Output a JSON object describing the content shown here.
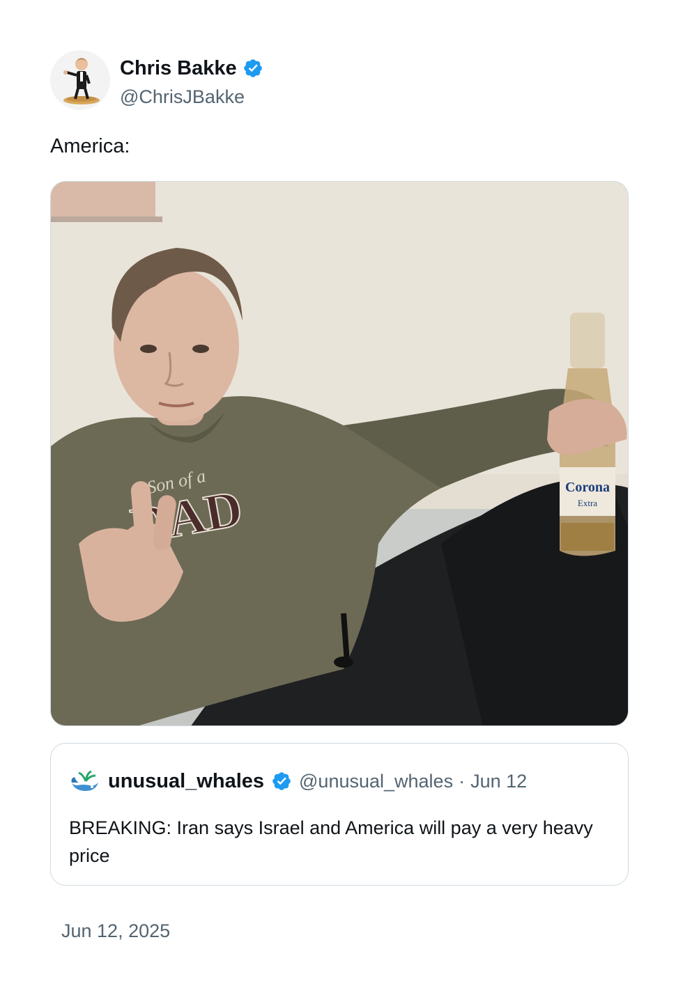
{
  "author": {
    "display_name": "Chris Bakke",
    "handle": "@ChrisJBakke",
    "verified": true,
    "avatar_icon": "bitmoji-avatar-icon"
  },
  "tweet": {
    "text": "America:",
    "media": {
      "kind": "photo",
      "sweatshirt_text": [
        "Son of a",
        "DAD"
      ],
      "bottle_label": [
        "Corona",
        "Extra"
      ]
    }
  },
  "quote": {
    "display_name": "unusual_whales",
    "handle": "@unusual_whales",
    "separator": "·",
    "date": "Jun 12",
    "text": "BREAKING: Iran says Israel and America will pay a very heavy price",
    "avatar_icon": "whale-icon",
    "verified": true
  },
  "timestamp": "Jun 12, 2025",
  "colors": {
    "text": "#0f1419",
    "secondary": "#536471",
    "verified": "#1d9bf0",
    "border": "#cfd9de"
  }
}
